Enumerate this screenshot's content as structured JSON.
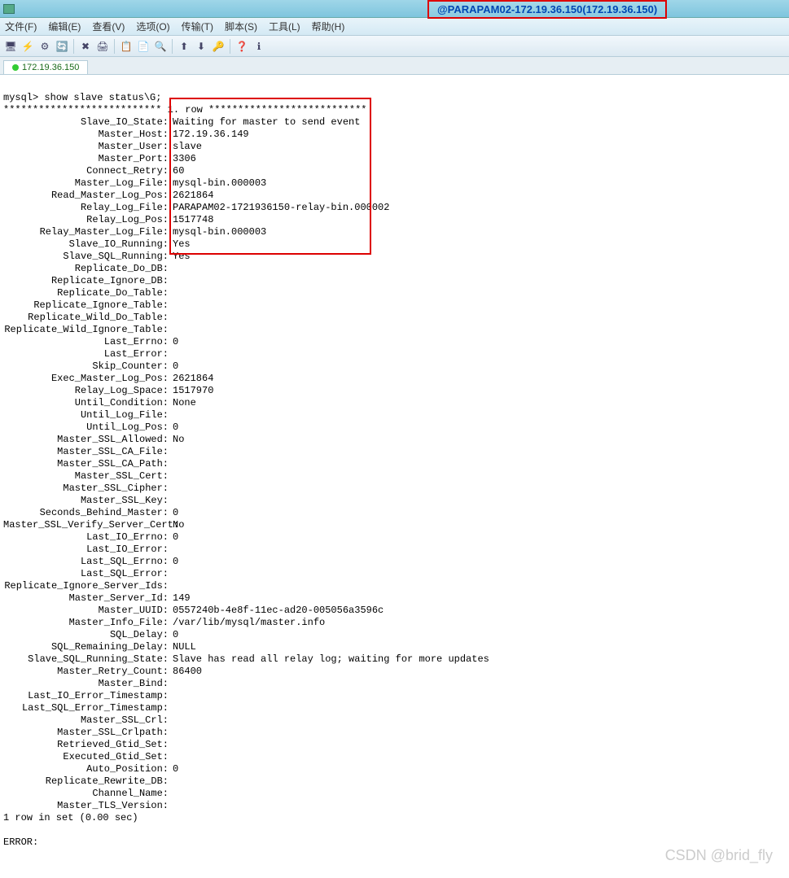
{
  "header": {
    "remote_label": "@PARAPAM02-172.19.36.150(172.19.36.150)"
  },
  "menu": {
    "file": "文件(F)",
    "edit": "编辑(E)",
    "view": "查看(V)",
    "options": "选项(O)",
    "transfer": "传输(T)",
    "script": "脚本(S)",
    "tools": "工具(L)",
    "help": "帮助(H)"
  },
  "tab": {
    "label": "172.19.36.150"
  },
  "terminal": {
    "prompt": "mysql> show slave status\\G;",
    "row_header": "*************************** 1. row ***************************",
    "fields": [
      {
        "k": "Slave_IO_State",
        "v": "Waiting for master to send event"
      },
      {
        "k": "Master_Host",
        "v": "172.19.36.149"
      },
      {
        "k": "Master_User",
        "v": "slave"
      },
      {
        "k": "Master_Port",
        "v": "3306"
      },
      {
        "k": "Connect_Retry",
        "v": "60"
      },
      {
        "k": "Master_Log_File",
        "v": "mysql-bin.000003"
      },
      {
        "k": "Read_Master_Log_Pos",
        "v": "2621864"
      },
      {
        "k": "Relay_Log_File",
        "v": "PARAPAM02-1721936150-relay-bin.000002"
      },
      {
        "k": "Relay_Log_Pos",
        "v": "1517748"
      },
      {
        "k": "Relay_Master_Log_File",
        "v": "mysql-bin.000003"
      },
      {
        "k": "Slave_IO_Running",
        "v": "Yes"
      },
      {
        "k": "Slave_SQL_Running",
        "v": "Yes"
      },
      {
        "k": "Replicate_Do_DB",
        "v": ""
      },
      {
        "k": "Replicate_Ignore_DB",
        "v": ""
      },
      {
        "k": "Replicate_Do_Table",
        "v": ""
      },
      {
        "k": "Replicate_Ignore_Table",
        "v": ""
      },
      {
        "k": "Replicate_Wild_Do_Table",
        "v": ""
      },
      {
        "k": "Replicate_Wild_Ignore_Table",
        "v": ""
      },
      {
        "k": "Last_Errno",
        "v": "0"
      },
      {
        "k": "Last_Error",
        "v": ""
      },
      {
        "k": "Skip_Counter",
        "v": "0"
      },
      {
        "k": "Exec_Master_Log_Pos",
        "v": "2621864"
      },
      {
        "k": "Relay_Log_Space",
        "v": "1517970"
      },
      {
        "k": "Until_Condition",
        "v": "None"
      },
      {
        "k": "Until_Log_File",
        "v": ""
      },
      {
        "k": "Until_Log_Pos",
        "v": "0"
      },
      {
        "k": "Master_SSL_Allowed",
        "v": "No"
      },
      {
        "k": "Master_SSL_CA_File",
        "v": ""
      },
      {
        "k": "Master_SSL_CA_Path",
        "v": ""
      },
      {
        "k": "Master_SSL_Cert",
        "v": ""
      },
      {
        "k": "Master_SSL_Cipher",
        "v": ""
      },
      {
        "k": "Master_SSL_Key",
        "v": ""
      },
      {
        "k": "Seconds_Behind_Master",
        "v": "0"
      },
      {
        "k": "Master_SSL_Verify_Server_Cert",
        "v": "No"
      },
      {
        "k": "Last_IO_Errno",
        "v": "0"
      },
      {
        "k": "Last_IO_Error",
        "v": ""
      },
      {
        "k": "Last_SQL_Errno",
        "v": "0"
      },
      {
        "k": "Last_SQL_Error",
        "v": ""
      },
      {
        "k": "Replicate_Ignore_Server_Ids",
        "v": ""
      },
      {
        "k": "Master_Server_Id",
        "v": "149"
      },
      {
        "k": "Master_UUID",
        "v": "0557240b-4e8f-11ec-ad20-005056a3596c"
      },
      {
        "k": "Master_Info_File",
        "v": "/var/lib/mysql/master.info"
      },
      {
        "k": "SQL_Delay",
        "v": "0"
      },
      {
        "k": "SQL_Remaining_Delay",
        "v": "NULL"
      },
      {
        "k": "Slave_SQL_Running_State",
        "v": "Slave has read all relay log; waiting for more updates"
      },
      {
        "k": "Master_Retry_Count",
        "v": "86400"
      },
      {
        "k": "Master_Bind",
        "v": ""
      },
      {
        "k": "Last_IO_Error_Timestamp",
        "v": ""
      },
      {
        "k": "Last_SQL_Error_Timestamp",
        "v": ""
      },
      {
        "k": "Master_SSL_Crl",
        "v": ""
      },
      {
        "k": "Master_SSL_Crlpath",
        "v": ""
      },
      {
        "k": "Retrieved_Gtid_Set",
        "v": ""
      },
      {
        "k": "Executed_Gtid_Set",
        "v": ""
      },
      {
        "k": "Auto_Position",
        "v": "0"
      },
      {
        "k": "Replicate_Rewrite_DB",
        "v": ""
      },
      {
        "k": "Channel_Name",
        "v": ""
      },
      {
        "k": "Master_TLS_Version",
        "v": ""
      }
    ],
    "footer": "1 row in set (0.00 sec)",
    "error": "ERROR:"
  },
  "watermark": "CSDN @brid_fly"
}
